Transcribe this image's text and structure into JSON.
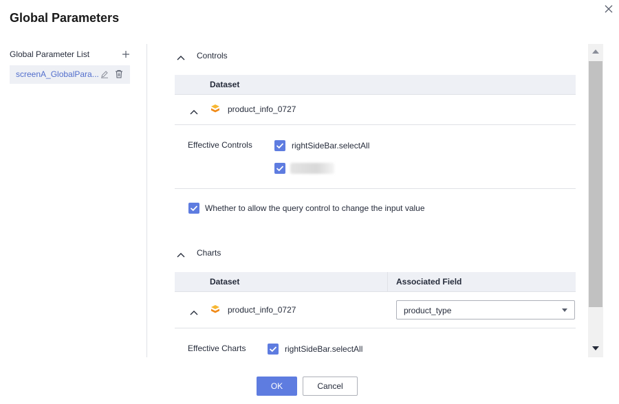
{
  "dialog": {
    "title": "Global Parameters",
    "close_icon": "close-icon"
  },
  "sidebar": {
    "header": "Global Parameter List",
    "items": [
      {
        "label": "screenA_GlobalPara..."
      }
    ]
  },
  "controls_section": {
    "title": "Controls",
    "table_header": "Dataset",
    "dataset_name": "product_info_0727",
    "effective_label": "Effective Controls",
    "effective_items": [
      {
        "label": "rightSideBar.selectAll",
        "checked": true
      },
      {
        "label": "",
        "checked": true,
        "blurred": true
      }
    ],
    "allow_query_label": "Whether to allow the query control to change the input value",
    "allow_query_checked": true
  },
  "charts_section": {
    "title": "Charts",
    "col_dataset": "Dataset",
    "col_field": "Associated Field",
    "dataset_name": "product_info_0727",
    "associated_field_value": "product_type",
    "effective_label": "Effective Charts",
    "effective_items": [
      {
        "label": "rightSideBar.selectAll",
        "checked": true
      }
    ]
  },
  "footer": {
    "ok_label": "OK",
    "cancel_label": "Cancel"
  },
  "colors": {
    "accent": "#5e7ce0",
    "link": "#526ecc",
    "dataset_icon": "#f59e1b"
  }
}
